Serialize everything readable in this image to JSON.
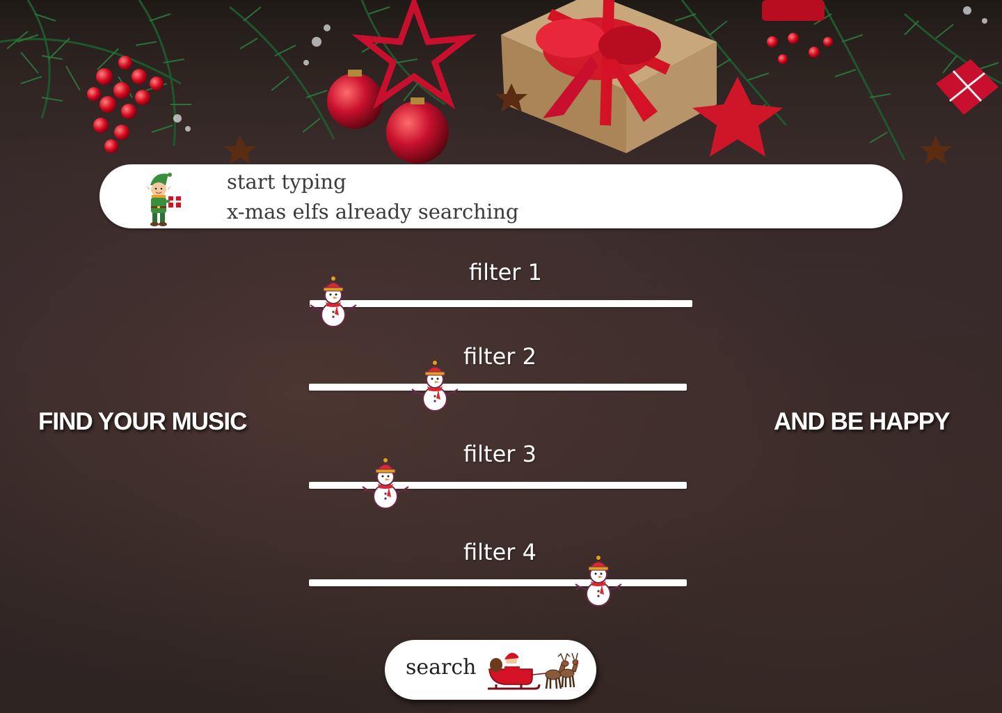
{
  "search": {
    "line1": "start typing",
    "line2": "x-mas elfs already searching"
  },
  "headline": {
    "left": "FIND YOUR MUSIC",
    "right": "AND BE HAPPY"
  },
  "filters": [
    {
      "label": "filter 1",
      "value": 0.06
    },
    {
      "label": "filter 2",
      "value": 0.33
    },
    {
      "label": "filter 3",
      "value": 0.2
    },
    {
      "label": "filter 4",
      "value": 0.77
    }
  ],
  "search_button": {
    "label": "search"
  },
  "icons": {
    "search_bar": "elf-icon",
    "slider_handle": "snowman-icon",
    "search_button": "santa-sleigh-icon"
  },
  "colors": {
    "background": "#33272a",
    "accent": "#c8102e",
    "text_light": "#ffffff"
  }
}
